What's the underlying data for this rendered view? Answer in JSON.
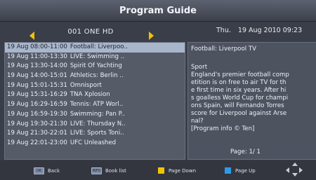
{
  "header": {
    "title": "Program Guide"
  },
  "channel": {
    "name": "001 ONE HD"
  },
  "datetime": {
    "day": "Thu.",
    "date": "19 Aug 2010 09:23"
  },
  "events": [
    {
      "time": "19 Aug 08:00-11:00",
      "title": "Football: Liverpoo..",
      "selected": true
    },
    {
      "time": "19 Aug 11:00-13:30",
      "title": "LIVE: Swimming ..",
      "selected": false
    },
    {
      "time": "19 Aug 13:30-14:00",
      "title": "Spirit Of Yachting",
      "selected": false
    },
    {
      "time": "19 Aug 14:00-15:01",
      "title": "Athletics: Berlin ..",
      "selected": false
    },
    {
      "time": "19 Aug 15:01-15:31",
      "title": "Omnisport",
      "selected": false
    },
    {
      "time": "19 Aug 15:31-16:29",
      "title": "TNA Xplosion",
      "selected": false
    },
    {
      "time": "19 Aug 16:29-16:59",
      "title": "Tennis: ATP Worl..",
      "selected": false
    },
    {
      "time": "19 Aug 16:59-19:30",
      "title": "Swimming: Pan P..",
      "selected": false
    },
    {
      "time": "19 Aug 19:30-21:30",
      "title": "LIVE: Thursday N..",
      "selected": false
    },
    {
      "time": "19 Aug 21:30-22:01",
      "title": "LIVE: Sports Toni..",
      "selected": false
    },
    {
      "time": "19 Aug 22:01-23:00",
      "title": "UFC Unleashed",
      "selected": false
    }
  ],
  "info": {
    "title": "Football: Liverpool TV",
    "genre": "Sport",
    "description": "England's premier football comp\netition is on free to air TV for th\ne first time in six years. After hi\ns goalless World Cup for champi\nons Spain, will Fernando Torres \nscore for Liverpool against Arse\nnal?\n[Program info © Ten]",
    "page_label": "Page:",
    "page_value": "1/ 1"
  },
  "footer": {
    "back_btn": "OK",
    "back_label": "Back",
    "booklist_btn": "INFO",
    "booklist_label": "Book list",
    "pagedown_label": "Page Down",
    "pageup_label": "Page Up"
  },
  "colors": {
    "accent_yellow": "#f2c400",
    "accent_blue": "#2e9be8",
    "selected_row": "#a8b6cc"
  },
  "icons": {
    "prev_channel": "arrow-left-icon",
    "next_channel": "arrow-right-icon",
    "dpad": "dpad-icon"
  }
}
